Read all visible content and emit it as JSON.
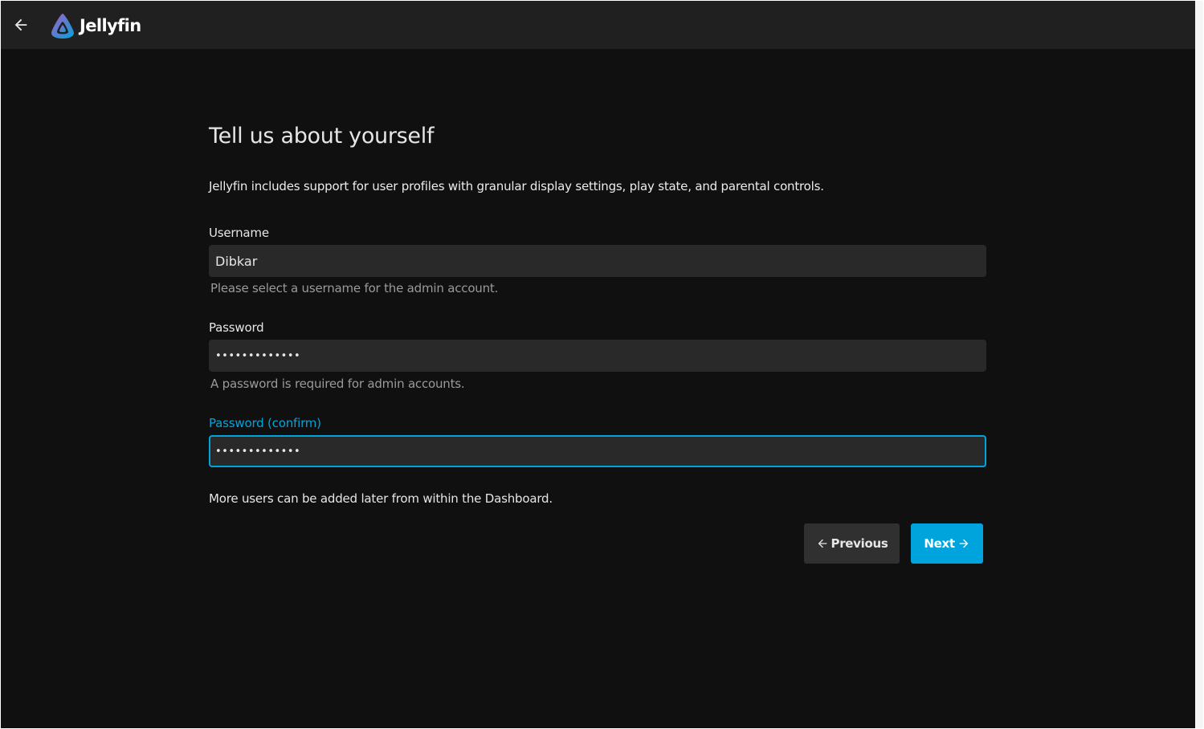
{
  "header": {
    "back_icon": "arrow-back-icon",
    "logo_icon": "jellyfin-logo-icon",
    "logo_text": "Jellyfin"
  },
  "main": {
    "title": "Tell us about yourself",
    "intro": "Jellyfin includes support for user profiles with granular display settings, play state, and parental controls.",
    "username": {
      "label": "Username",
      "value": "Dibkar",
      "hint": "Please select a username for the admin account."
    },
    "password": {
      "label": "Password",
      "value": "•••••••••••••",
      "hint": "A password is required for admin accounts."
    },
    "password_confirm": {
      "label": "Password (confirm)",
      "value": "•••••••••••••"
    },
    "footer_note": "More users can be added later from within the Dashboard.",
    "previous_label": "Previous",
    "next_label": "Next"
  },
  "colors": {
    "accent": "#00a4dc",
    "background": "#101010",
    "header": "#202020",
    "input": "#292929"
  }
}
